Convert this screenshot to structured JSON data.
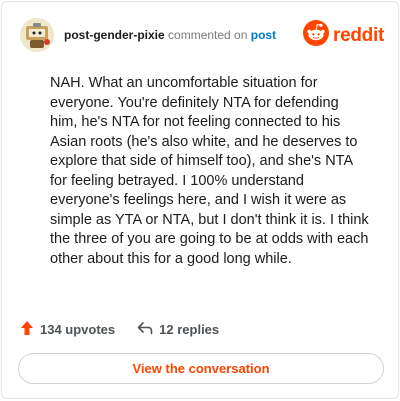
{
  "header": {
    "username": "post-gender-pixie",
    "action": "commented on",
    "target": "post",
    "brand": "reddit"
  },
  "comment": {
    "text": "NAH. What an uncomfortable situation for everyone. You're definitely NTA for defending him, he's NTA for not feeling connected to his Asian roots (he's also white, and he deserves to explore that side of himself too), and she's NTA for feeling betrayed. I 100% understand everyone's feelings here, and I wish it were as simple as YTA or NTA, but I don't think it is. I think the three of you are going to be at odds with each other about this for a good long while."
  },
  "stats": {
    "upvotes": "134 upvotes",
    "replies": "12 replies"
  },
  "cta": {
    "label": "View the conversation"
  },
  "colors": {
    "brand": "#ff4500",
    "link": "#0079d3",
    "text": "#1c1c1c",
    "muted": "#7c7c7c"
  },
  "icons": {
    "avatar": "snoo-avatar-icon",
    "brand": "reddit-logo-icon",
    "upvote": "upvote-arrow-icon",
    "reply": "reply-arrow-icon"
  }
}
